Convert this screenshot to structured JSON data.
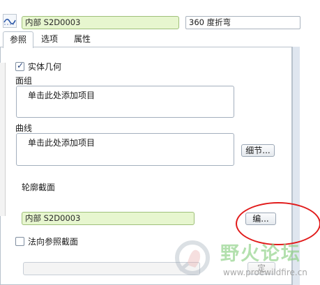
{
  "header": {
    "sketch_icon": "sketch-icon",
    "reference_field": "内部 S2D0003",
    "name_field": "360 度折弯"
  },
  "tabs": [
    {
      "label": "参照"
    },
    {
      "label": "选项"
    },
    {
      "label": "属性"
    }
  ],
  "references": {
    "solid_geometry_label": "实体几何",
    "solid_geometry_checked": true,
    "quilt_label": "面组",
    "quilt_placeholder": "单击此处添加项目",
    "curve_label": "曲线",
    "curve_placeholder": "单击此处添加项目",
    "details_button": "细节...",
    "profile_section_label": "轮廓截面",
    "profile_field": "内部 S2D0003",
    "edit_button": "编...",
    "normal_ref_label": "法向参照截面",
    "normal_ref_checked": false,
    "define_button": "定"
  },
  "annotation": {
    "color": "#e11b1b"
  },
  "watermark": {
    "text": "野火论坛",
    "url": "www.proewildfire.cn"
  }
}
